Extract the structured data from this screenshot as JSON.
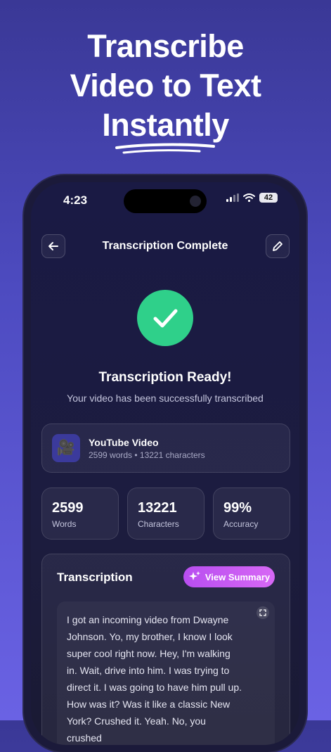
{
  "headline": {
    "line1": "Transcribe",
    "line2": "Video to Text",
    "line3": "Instantly"
  },
  "status_bar": {
    "time": "4:23",
    "battery": "42"
  },
  "nav": {
    "title": "Transcription Complete",
    "back_icon": "arrow-left-icon",
    "edit_icon": "pencil-icon"
  },
  "result": {
    "title": "Transcription Ready!",
    "subtitle": "Your video has been successfully transcribed"
  },
  "video": {
    "title": "YouTube Video",
    "meta": "2599 words • 13221 characters",
    "icon": "movie-camera-icon"
  },
  "stats": [
    {
      "value": "2599",
      "label": "Words"
    },
    {
      "value": "13221",
      "label": "Characters"
    },
    {
      "value": "99%",
      "label": "Accuracy"
    }
  ],
  "transcription": {
    "title": "Transcription",
    "summary_button": "View Summary",
    "text": "I got an incoming video from Dwayne Johnson. Yo, my brother, I know I look super cool right now. Hey, I'm walking in. Wait, drive into him. I was trying to direct it. I was going to have him pull up. How was it? Was it like a classic New York? Crushed it. Yeah. No, you crushed"
  },
  "colors": {
    "accent_green": "#2fd08a",
    "summary_gradient_start": "#b84ef0",
    "summary_gradient_end": "#d768f5",
    "background_top": "#3a3896",
    "background_bottom": "#6a62e4"
  }
}
